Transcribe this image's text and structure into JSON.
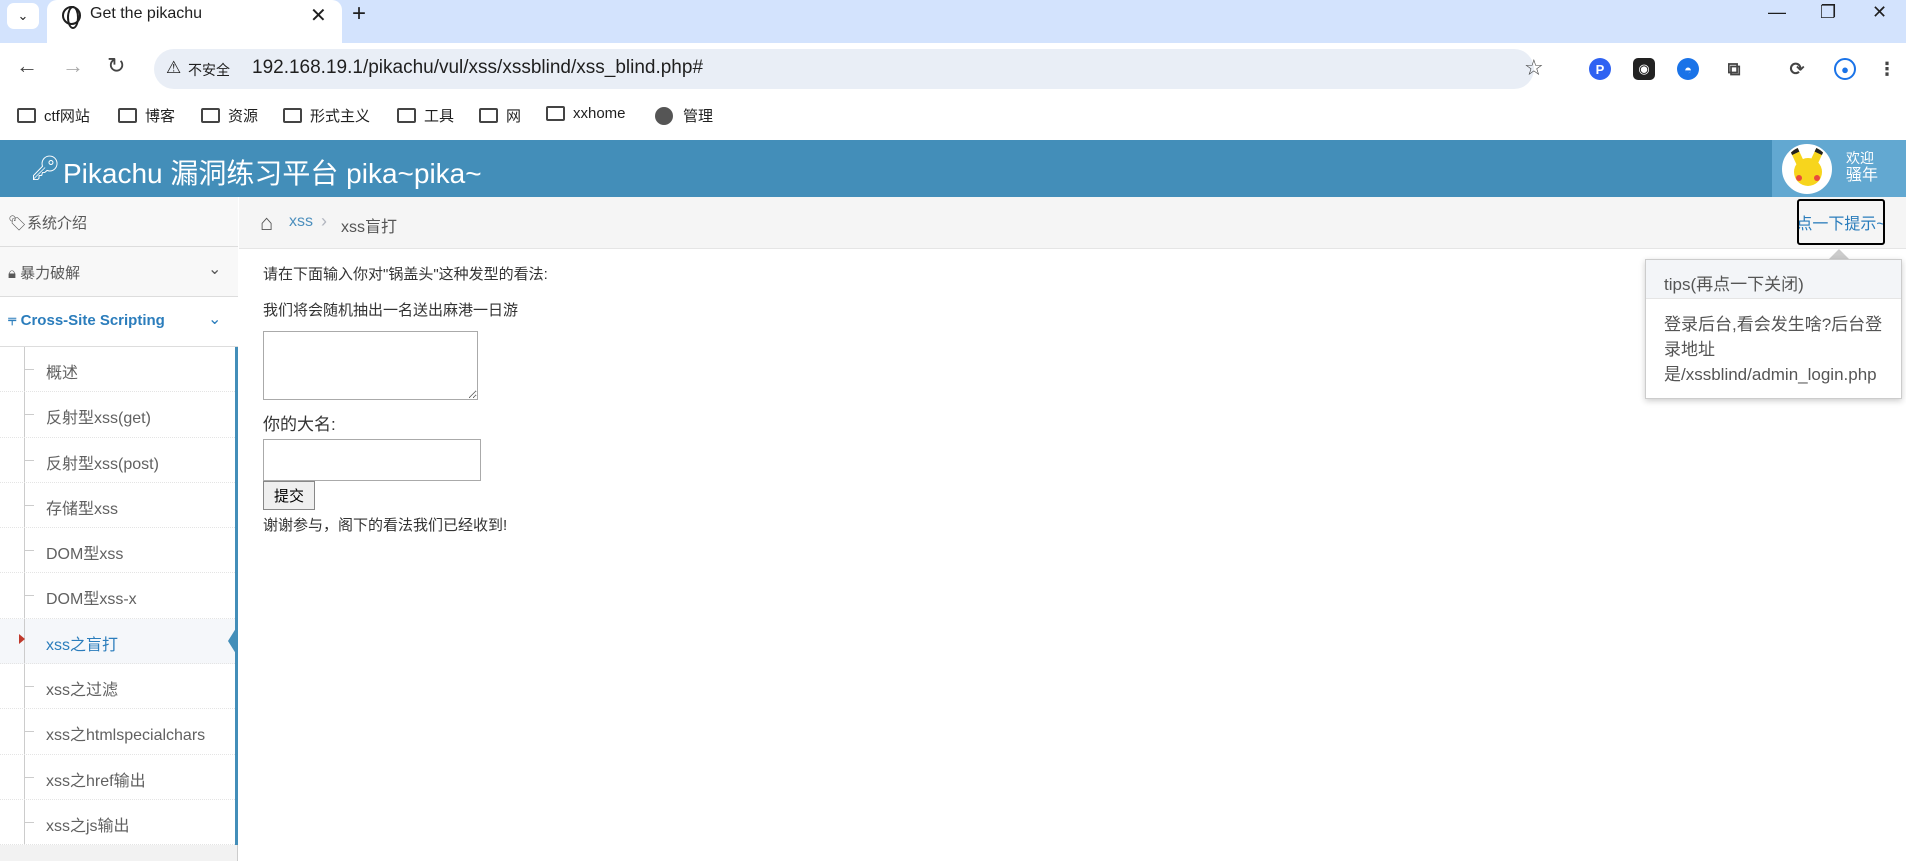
{
  "browser": {
    "tab_title": "Get the pikachu",
    "not_secure_label": "不安全",
    "url": "192.168.19.1/pikachu/vul/xss/xssblind/xss_blind.php#",
    "bookmarks": [
      "ctf网站",
      "博客",
      "资源",
      "形式主义",
      "工具",
      "网",
      "xxhome",
      "管理"
    ]
  },
  "header": {
    "brand": "Pikachu 漏洞练习平台 pika~pika~",
    "welcome": "欢迎",
    "username": "骚年"
  },
  "sidebar": {
    "items": [
      {
        "label": "系统介绍"
      },
      {
        "label": "暴力破解"
      },
      {
        "label": "Cross-Site Scripting"
      }
    ],
    "submenu": [
      {
        "label": "概述"
      },
      {
        "label": "反射型xss(get)"
      },
      {
        "label": "反射型xss(post)"
      },
      {
        "label": "存储型xss"
      },
      {
        "label": "DOM型xss"
      },
      {
        "label": "DOM型xss-x"
      },
      {
        "label": "xss之盲打"
      },
      {
        "label": "xss之过滤"
      },
      {
        "label": "xss之htmlspecialchars"
      },
      {
        "label": "xss之href输出"
      },
      {
        "label": "xss之js输出"
      }
    ],
    "active_submenu_index": 6
  },
  "breadcrumb": {
    "link": "xss",
    "current": "xss盲打",
    "hint_button": "点一下提示~"
  },
  "content": {
    "question": "请在下面输入你对\"锅盖头\"这种发型的看法:",
    "prize": "我们将会随机抽出一名送出麻港一日游",
    "message_value": "",
    "name_label": "你的大名:",
    "name_value": "",
    "submit_label": "提交",
    "thanks": "谢谢参与，阁下的看法我们已经收到!"
  },
  "popover": {
    "title": "tips(再点一下关闭)",
    "body": "登录后台,看会发生啥?后台登录地址是/xssblind/admin_login.php"
  },
  "colors": {
    "header_bg": "#438eb9",
    "accent": "#2b7dbc",
    "tabbar_bg": "#d3e3fd"
  }
}
